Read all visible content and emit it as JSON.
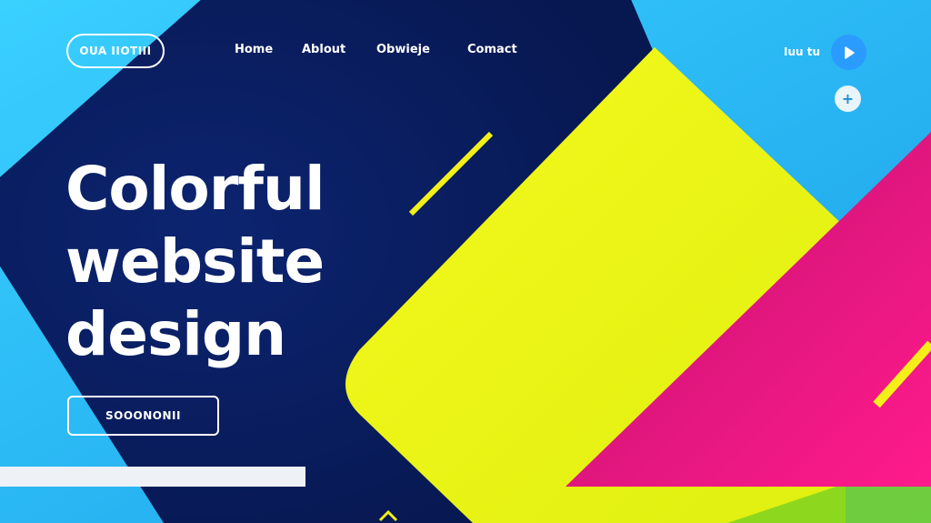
{
  "header": {
    "logo_label": "OUA IIOTIII",
    "nav": [
      {
        "label": "Home"
      },
      {
        "label": "Ablout"
      },
      {
        "label": "Obwieje"
      },
      {
        "label": "Comact"
      }
    ],
    "right_label": "Iuu tu"
  },
  "hero": {
    "title_lines": [
      "Colorful",
      "website",
      "design"
    ],
    "cta_label": "SOOONONII"
  },
  "colors": {
    "navy": "#0b1f63",
    "cyan": "#1fb6f2",
    "yellow": "#f2f21a",
    "magenta": "#e8188a",
    "accent_blue": "#2a9bff"
  }
}
